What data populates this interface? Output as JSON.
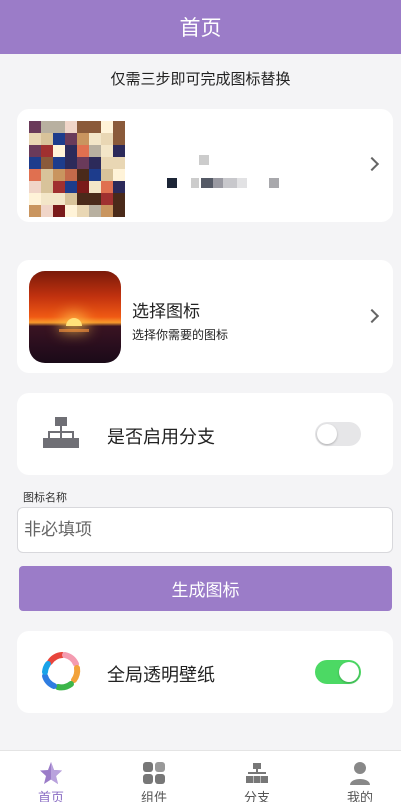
{
  "header": {
    "title": "首页"
  },
  "intro": {
    "text": "仅需三步即可完成图标替换"
  },
  "icon_picker": {
    "title": "选择图标",
    "description": "选择你需要的图标"
  },
  "branch": {
    "label": "是否启用分支",
    "enabled": false
  },
  "name_field": {
    "label": "图标名称",
    "placeholder": "非必填项",
    "value": ""
  },
  "generate": {
    "label": "生成图标"
  },
  "wallpaper": {
    "label": "全局透明壁纸",
    "enabled": true
  },
  "colors": {
    "accent": "#9b7cc8",
    "toggle_on": "#4cd964"
  },
  "tabbar": {
    "tabs": [
      {
        "label": "首页",
        "icon": "star-icon",
        "active": true
      },
      {
        "label": "组件",
        "icon": "grid-icon",
        "active": false
      },
      {
        "label": "分支",
        "icon": "branch-icon",
        "active": false
      },
      {
        "label": "我的",
        "icon": "person-icon",
        "active": false
      }
    ]
  }
}
